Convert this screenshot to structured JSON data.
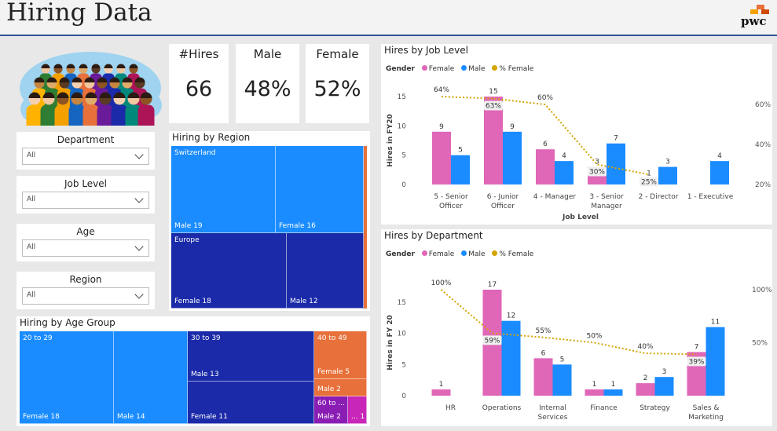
{
  "header": {
    "title": "Hiring Data",
    "logo_text": "pwc"
  },
  "colors": {
    "female": "#e066b8",
    "male": "#1a8cff",
    "pct_female": "#d4a500",
    "dark_navy": "#1a2aa8",
    "orange": "#e8703a",
    "purple": "#8a1db4",
    "magenta": "#c726b8"
  },
  "kpis": [
    {
      "label": "#Hires",
      "value": "66"
    },
    {
      "label": "Male",
      "value": "48%"
    },
    {
      "label": "Female",
      "value": "52%"
    }
  ],
  "slicers": [
    {
      "label": "Department",
      "value": "All"
    },
    {
      "label": "Job Level",
      "value": "All"
    },
    {
      "label": "Age",
      "value": "All"
    },
    {
      "label": "Region",
      "value": "All"
    }
  ],
  "region_treemap": {
    "title": "Hiring by Region",
    "groups": [
      {
        "name": "Switzerland",
        "tiles": [
          "Male 19",
          "Female 16"
        ]
      },
      {
        "name": "Europe",
        "tiles": [
          "Female 18",
          "Male 12"
        ]
      }
    ]
  },
  "age_treemap": {
    "title": "Hiring by Age Group",
    "tiles": {
      "a20_label": "20 to 29",
      "a20_female": "Female 18",
      "a20_male": "Male 14",
      "a30_label": "30 to 39",
      "a30_male": "Male 13",
      "a30_female": "Female 11",
      "a40_label": "40 to 49",
      "a40_female": "Female 5",
      "a40_male": "Male 2",
      "a60_label": "60 to ...",
      "a60_male": "Male 2",
      "a60_other": "... 1"
    }
  },
  "legend": {
    "title": "Gender",
    "female": "Female",
    "male": "Male",
    "pct": "% Female"
  },
  "chart_data": [
    {
      "type": "bar",
      "title": "Hires by Job Level",
      "categories": [
        [
          "5 - Senior",
          "Officer"
        ],
        [
          "6 - Junior",
          "Officer"
        ],
        [
          "4 - Manager"
        ],
        [
          "3 - Senior",
          "Manager"
        ],
        [
          "2 - Director"
        ],
        [
          "1 - Executive"
        ]
      ],
      "series": [
        {
          "name": "Female",
          "values": [
            9,
            15,
            6,
            3,
            1,
            0
          ]
        },
        {
          "name": "Male",
          "values": [
            5,
            9,
            4,
            7,
            3,
            4
          ]
        },
        {
          "name": "% Female",
          "axis": "right",
          "values": [
            64,
            63,
            60,
            30,
            25,
            null
          ],
          "labels": [
            "64%",
            "63%",
            "60%",
            "30%",
            "25%",
            ""
          ]
        }
      ],
      "bar_labels": {
        "female": [
          "9",
          "15",
          "6",
          "3",
          "1",
          ""
        ],
        "male": [
          "5",
          "9",
          "4",
          "7",
          "3",
          "4"
        ]
      },
      "xlabel": "Job Level",
      "ylabel": "Hires in FY20",
      "ylim": [
        0,
        15
      ],
      "yticks": [
        "0",
        "5",
        "10",
        "15"
      ],
      "y2lim": [
        20,
        64
      ],
      "y2ticks": [
        "20%",
        "40%",
        "60%"
      ]
    },
    {
      "type": "bar",
      "title": "Hires by Department",
      "categories": [
        [
          "HR"
        ],
        [
          "Operations"
        ],
        [
          "Internal",
          "Services"
        ],
        [
          "Finance"
        ],
        [
          "Strategy"
        ],
        [
          "Sales &",
          "Marketing"
        ]
      ],
      "series": [
        {
          "name": "Female",
          "values": [
            1,
            17,
            6,
            1,
            2,
            7
          ]
        },
        {
          "name": "Male",
          "values": [
            0,
            12,
            5,
            1,
            3,
            11
          ]
        },
        {
          "name": "% Female",
          "axis": "right",
          "values": [
            100,
            59,
            55,
            50,
            40,
            39
          ],
          "labels": [
            "100%",
            "59%",
            "55%",
            "50%",
            "40%",
            "39%"
          ]
        }
      ],
      "bar_labels": {
        "female": [
          "1",
          "17",
          "6",
          "1",
          "2",
          "7"
        ],
        "male": [
          "",
          "12",
          "5",
          "1",
          "3",
          "11"
        ]
      },
      "xlabel": "",
      "ylabel": "Hires in FY 20",
      "ylim": [
        0,
        17
      ],
      "yticks": [
        "0",
        "5",
        "10",
        "15"
      ],
      "y2lim": [
        0,
        100
      ],
      "y2ticks": [
        "50%",
        "100%"
      ]
    }
  ]
}
